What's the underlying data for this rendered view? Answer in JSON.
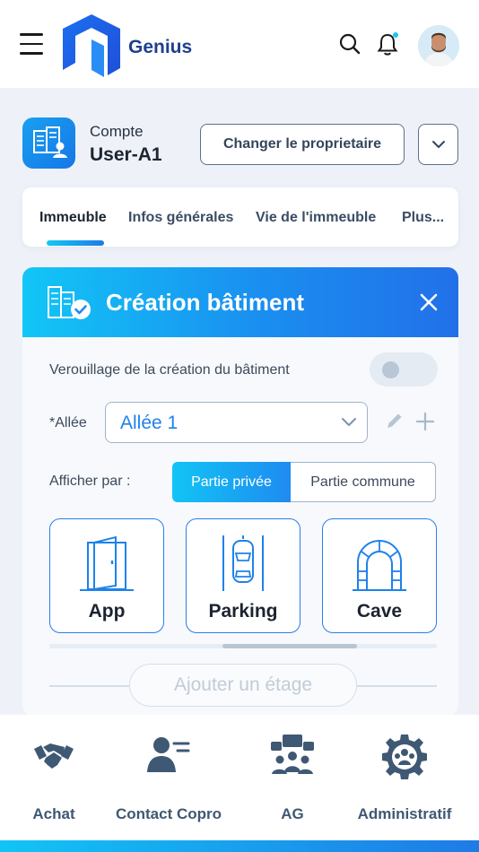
{
  "header": {
    "brand": "Genius",
    "menu_icon": "hamburger-icon",
    "search_icon": "search-icon",
    "notification_icon": "bell-icon",
    "notification_dot_color": "#22c5f0"
  },
  "account": {
    "label": "Compte",
    "user": "User-A1",
    "change_owner_label": "Changer le proprietaire"
  },
  "tabs": [
    {
      "label": "Immeuble",
      "active": true
    },
    {
      "label": "Infos générales"
    },
    {
      "label": "Vie de l'immeuble"
    },
    {
      "label": "Plus..."
    }
  ],
  "card": {
    "title": "Création bâtiment",
    "lock_label": "Verouillage de la création du bâtiment",
    "lock_enabled": false,
    "allee_label": "*Allée",
    "allee_value": "Allée 1",
    "afficher_label": "Afficher par :",
    "segments": [
      {
        "label": "Partie privée",
        "selected": true
      },
      {
        "label": "Partie commune",
        "selected": false
      }
    ],
    "tiles": [
      {
        "label": "App",
        "icon": "door-icon"
      },
      {
        "label": "Parking",
        "icon": "car-parking-icon"
      },
      {
        "label": "Cave",
        "icon": "cellar-arch-icon"
      }
    ],
    "add_floor_label": "Ajouter un étage"
  },
  "bottom_nav": [
    {
      "label": "Achat",
      "icon": "handshake-icon"
    },
    {
      "label": "Contact Copro",
      "icon": "contact-icon"
    },
    {
      "label": "AG",
      "icon": "meeting-icon"
    },
    {
      "label": "Administratif",
      "icon": "admin-gear-icon"
    }
  ],
  "colors": {
    "accent": "#1e82ea",
    "accent_light": "#12c6f6",
    "nav": "#3f5873"
  }
}
